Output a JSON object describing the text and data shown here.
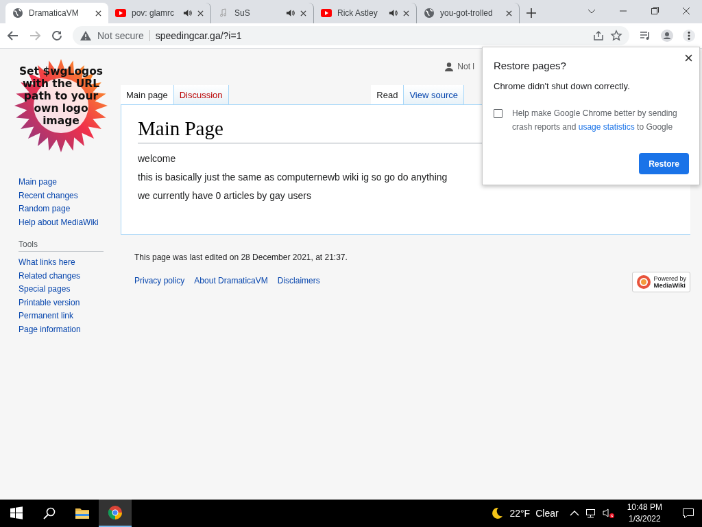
{
  "browser": {
    "tabs": [
      {
        "title": "DramaticaVM",
        "kind": "globe",
        "audio": false,
        "selected": true
      },
      {
        "title": "pov: glamrc",
        "kind": "video",
        "audio": true,
        "selected": false
      },
      {
        "title": "SuS",
        "kind": "file",
        "audio": true,
        "selected": false
      },
      {
        "title": "Rick Astley",
        "kind": "video",
        "audio": true,
        "selected": false
      },
      {
        "title": "you-got-trolled",
        "kind": "globe",
        "audio": false,
        "selected": false
      }
    ],
    "address": {
      "security": "Not secure",
      "url": "speedingcar.ga/?i=1"
    }
  },
  "wiki": {
    "logo_text": "Set $wgLogos with the URL path to your own logo image",
    "user_link": "Not l",
    "nav": [
      "Main page",
      "Recent changes",
      "Random page",
      "Help about MediaWiki"
    ],
    "tools": {
      "heading": "Tools",
      "items": [
        "What links here",
        "Related changes",
        "Special pages",
        "Printable version",
        "Permanent link",
        "Page information"
      ]
    },
    "page_tabs_left": [
      {
        "label": "Main page",
        "selected": true,
        "missing": false
      },
      {
        "label": "Discussion",
        "selected": false,
        "missing": true
      }
    ],
    "page_tabs_right": [
      {
        "label": "Read",
        "selected": true
      },
      {
        "label": "View source",
        "selected": false
      }
    ],
    "title": "Main Page",
    "paragraphs": [
      "welcome",
      "this is basically just the same as computernewb wiki ig so go do anything",
      "we currently have 0 articles by gay users"
    ],
    "last_edited": "This page was last edited on 28 December 2021, at 21:37.",
    "footer_links": [
      "Privacy policy",
      "About DramaticaVM",
      "Disclaimers"
    ],
    "powered_by": {
      "line1": "Powered by",
      "line2": "MediaWiki"
    }
  },
  "dialog": {
    "title": "Restore pages?",
    "message": "Chrome didn't shut down correctly.",
    "checkbox": {
      "checked": false,
      "text_before": "Help make Google Chrome better by sending crash reports and ",
      "link": "usage statistics",
      "text_after": " to Google"
    },
    "button": "Restore"
  },
  "taskbar": {
    "apps": [
      {
        "kind": "folder",
        "active": false
      },
      {
        "kind": "chrome",
        "active": true
      }
    ],
    "weather": {
      "temp": "22°F",
      "condition": "Clear"
    },
    "time": "10:48 PM",
    "date": "1/3/2022"
  }
}
